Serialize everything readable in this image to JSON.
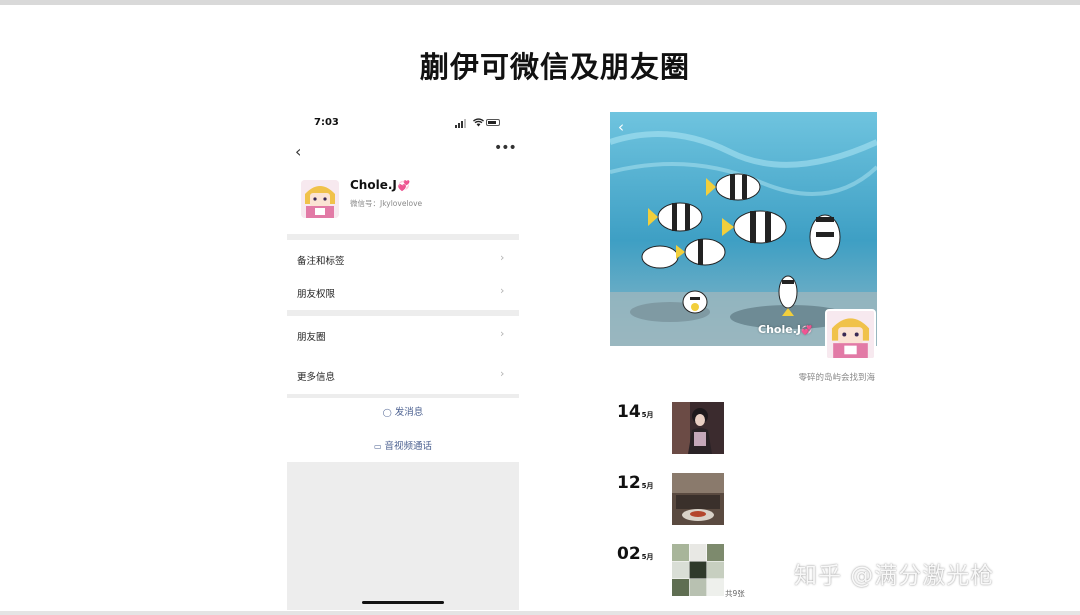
{
  "slide": {
    "title": "蒯伊可微信及朋友圈"
  },
  "phone": {
    "status": {
      "time": "7:03"
    },
    "profile": {
      "name": "Chole.J",
      "name_emoji": "💞",
      "wechat_id": "微信号：Jkylovelove"
    },
    "menu_group_1": [
      {
        "label": "备注和标签"
      },
      {
        "label": "朋友权限"
      }
    ],
    "menu_group_2": [
      {
        "label": "朋友圈"
      },
      {
        "label": "更多信息"
      }
    ],
    "actions": {
      "message": "发消息",
      "video_call": "音视频通话"
    },
    "icons": {
      "back": "chevron-left-icon",
      "more": "more-dots-icon",
      "chevron": "chevron-right-icon",
      "message": "chat-bubble-icon",
      "video": "video-camera-icon"
    }
  },
  "moments": {
    "cover_name": "Chole.J",
    "cover_emoji": "💞",
    "signature": "零碎的岛屿会找到海",
    "posts": [
      {
        "day": "14",
        "month": "5月",
        "count": ""
      },
      {
        "day": "12",
        "month": "5月",
        "count": ""
      },
      {
        "day": "02",
        "month": "5月",
        "count": "共9张"
      }
    ]
  },
  "watermark": "知乎 @满分激光枪",
  "colors": {
    "link_blue": "#4a5f8f",
    "sea_blue": "#47a6c8",
    "phone_bg": "#ededed"
  }
}
